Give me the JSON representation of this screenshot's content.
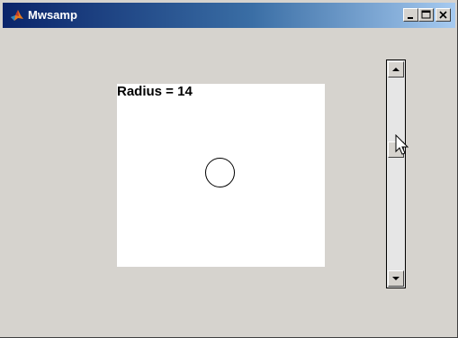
{
  "window": {
    "title": "Mwsamp"
  },
  "canvas": {
    "radius_label": "Radius = 14"
  },
  "scrollbar": {
    "orientation": "vertical",
    "thumb_position_fraction": 0.36
  },
  "icons": {
    "app": "matlab-icon",
    "minimize": "minimize-icon",
    "maximize": "maximize-icon",
    "close": "close-icon",
    "scroll_up": "arrow-up-icon",
    "scroll_down": "arrow-down-icon",
    "cursor": "mouse-pointer-icon"
  },
  "colors": {
    "title_bar_start": "#0a246a",
    "title_bar_end": "#a6caf0",
    "face": "#d6d3ce",
    "canvas_bg": "#ffffff"
  }
}
